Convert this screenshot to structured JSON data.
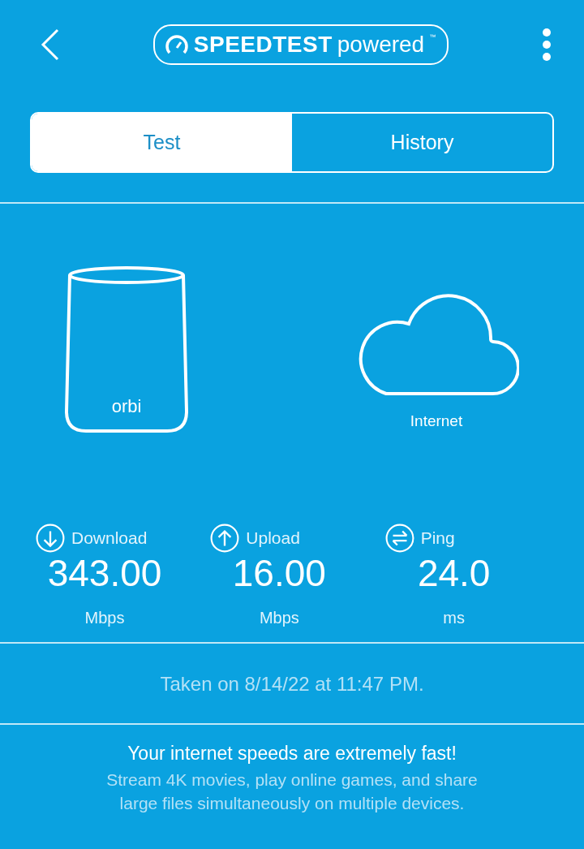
{
  "header": {
    "logo_bold": "SPEEDTEST",
    "logo_light": "powered",
    "logo_mark": "™"
  },
  "tabs": [
    {
      "label": "Test",
      "selected": true
    },
    {
      "label": "History",
      "selected": false
    }
  ],
  "devices": {
    "router_label": "orbi",
    "internet_label": "Internet"
  },
  "metrics": [
    {
      "kind": "download",
      "label": "Download",
      "value": "343.00",
      "unit": "Mbps"
    },
    {
      "kind": "upload",
      "label": "Upload",
      "value": "16.00",
      "unit": "Mbps"
    },
    {
      "kind": "ping",
      "label": "Ping",
      "value": "24.0",
      "unit": "ms"
    }
  ],
  "taken": "Taken on 8/14/22 at 11:47 PM.",
  "message": {
    "title": "Your internet speeds are extremely fast!",
    "body": "Stream 4K movies, play online games, and share large files simultaneously on multiple devices."
  }
}
